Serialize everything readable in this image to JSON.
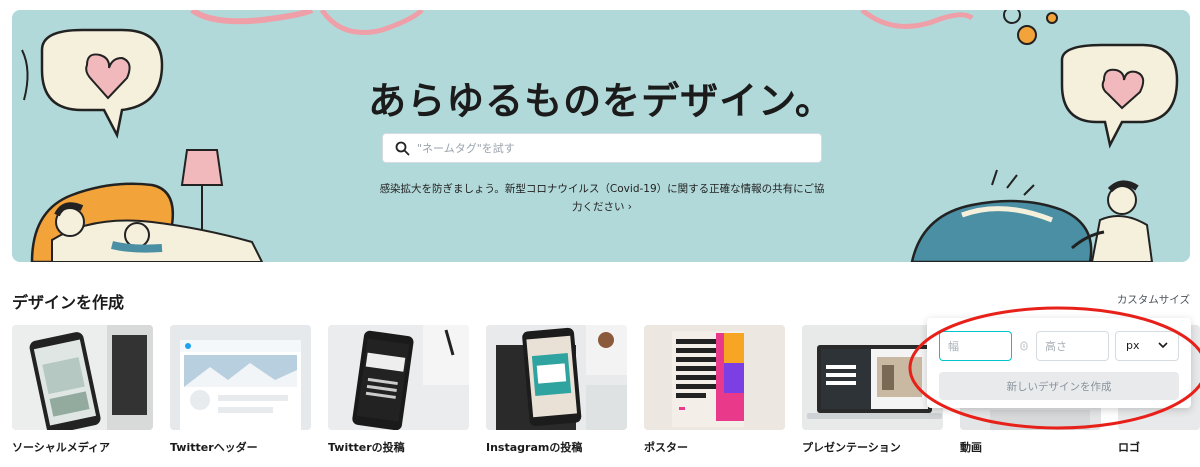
{
  "hero": {
    "title": "あらゆるものをデザイン。",
    "search_placeholder": "\"ネームタグ\"を試す",
    "notice_text": "感染拡大を防ぎましょう。新型コロナウイルス（Covid-19）に関する正確な情報の共有にご協",
    "notice_link": "力ください ›"
  },
  "create_section": {
    "title": "デザインを作成",
    "custom_size_label": "カスタムサイズ"
  },
  "cards": [
    {
      "label": "ソーシャルメディア"
    },
    {
      "label": "Twitterヘッダー"
    },
    {
      "label": "Twitterの投稿"
    },
    {
      "label": "Instagramの投稿"
    },
    {
      "label": "ポスター"
    },
    {
      "label": "プレゼンテーション"
    },
    {
      "label": "動画"
    },
    {
      "label": "ロゴ"
    }
  ],
  "custom_popup": {
    "width_placeholder": "幅",
    "height_placeholder": "高さ",
    "unit_value": "px",
    "create_button": "新しいデザインを作成"
  },
  "thumb_text": {
    "insta": "SUMMER IS HERE!",
    "poster": "SHOW YOUR TRUE COLORS. PROUDLY. BRIGHTLY.",
    "presentation": "Collab Space Central"
  },
  "colors": {
    "hero_bg": "#b2d9d9",
    "accent_teal": "#00c4cc",
    "highlight_red": "#e8201a"
  }
}
